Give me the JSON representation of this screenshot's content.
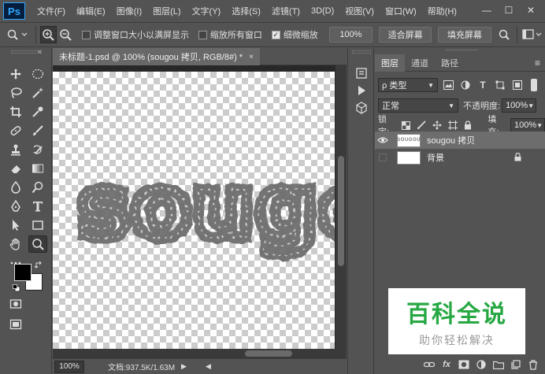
{
  "app": {
    "logo": "Ps"
  },
  "menu": [
    "文件(F)",
    "编辑(E)",
    "图像(I)",
    "图层(L)",
    "文字(Y)",
    "选择(S)",
    "滤镜(T)",
    "3D(D)",
    "视图(V)",
    "窗口(W)",
    "帮助(H)"
  ],
  "window_controls": {
    "minimize": "—",
    "maximize": "☐",
    "close": "✕"
  },
  "options_bar": {
    "resize_windows_label": "调整窗口大小以满屏显示",
    "resize_windows_checked": false,
    "zoom_all_label": "缩放所有窗口",
    "zoom_all_checked": false,
    "scrubby_zoom_label": "细微缩放",
    "scrubby_zoom_checked": true,
    "zoom_value": "100%",
    "fit_screen_label": "适合屏幕",
    "fill_screen_label": "填充屏幕"
  },
  "document": {
    "tab_title": "未标题-1.psd @ 100% (sougou 拷贝, RGB/8#) *",
    "close_glyph": "×",
    "canvas_text": "sougou",
    "zoom": "100%",
    "doc_info": "文档:937.5K/1.63M"
  },
  "layers_panel": {
    "tabs": [
      "图层",
      "通道",
      "路径"
    ],
    "active_tab": 0,
    "menu_glyph": "≡",
    "filter_kind_label": "ρ 类型",
    "blend_mode": "正常",
    "opacity_label": "不透明度:",
    "opacity_value": "100%",
    "lock_label": "锁定:",
    "fill_label": "填充:",
    "fill_value": "100%",
    "layers": [
      {
        "name": "sougou 拷贝",
        "visible": true,
        "selected": true,
        "thumb_text": "SOUGOU"
      },
      {
        "name": "背景",
        "visible": false,
        "selected": false,
        "locked": true
      }
    ],
    "bottom_icons": [
      "link-icon",
      "fx-icon",
      "mask-icon",
      "adjustment-icon",
      "group-icon",
      "new-layer-icon",
      "trash-icon"
    ],
    "fx_label": "fx"
  },
  "watermark": {
    "title": "百科全说",
    "subtitle": "助你轻松解决"
  },
  "colors": {
    "ui_bg": "#535353",
    "dark_bg": "#282828",
    "ps_blue": "#31a8ff",
    "watermark_green": "#27a843",
    "foreground_color": "#000000",
    "background_color": "#ffffff"
  }
}
